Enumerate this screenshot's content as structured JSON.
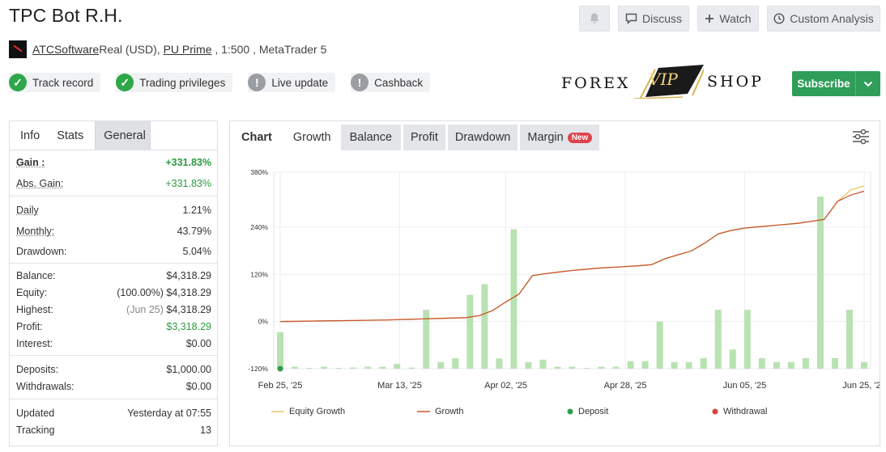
{
  "header": {
    "title": "TPC Bot R.H.",
    "author": "ATCSoftware",
    "account_type": "Real (USD), ",
    "broker": "PU Prime",
    "leverage_platform": " , 1:500 , MetaTrader 5"
  },
  "top_buttons": {
    "discuss": "Discuss",
    "watch": "Watch",
    "custom_analysis": "Custom Analysis"
  },
  "badges": [
    {
      "label": "Track record",
      "status": "ok"
    },
    {
      "label": "Trading privileges",
      "status": "ok"
    },
    {
      "label": "Live update",
      "status": "info"
    },
    {
      "label": "Cashback",
      "status": "info"
    }
  ],
  "ad": {
    "left": "FOREX",
    "mid": "VIP",
    "right": "SHOP"
  },
  "subscribe": {
    "label": "Subscribe"
  },
  "left_tabs": [
    "Info",
    "Stats",
    "General"
  ],
  "stats": {
    "gain_label": "Gain :",
    "gain": "+331.83%",
    "abs_gain_label": "Abs. Gain:",
    "abs_gain": "+331.83%",
    "daily_label": "Daily",
    "daily": "1.21%",
    "monthly_label": "Monthly:",
    "monthly": "43.79%",
    "drawdown_label": "Drawdown:",
    "drawdown": "5.04%",
    "balance_label": "Balance:",
    "balance": "$4,318.29",
    "equity_label": "Equity:",
    "equity_pct": "(100.00%)",
    "equity": "$4,318.29",
    "highest_label": "Highest:",
    "highest_date": "(Jun 25)",
    "highest": "$4,318.29",
    "profit_label": "Profit:",
    "profit": "$3,318.29",
    "interest_label": "Interest:",
    "interest": "$0.00",
    "deposits_label": "Deposits:",
    "deposits": "$1,000.00",
    "withdrawals_label": "Withdrawals:",
    "withdrawals": "$0.00",
    "updated_label": "Updated",
    "updated": "Yesterday at 07:55",
    "tracking_label": "Tracking",
    "tracking": "13"
  },
  "chart_tabs": {
    "chart": "Chart",
    "growth": "Growth",
    "balance": "Balance",
    "profit": "Profit",
    "drawdown": "Drawdown",
    "margin": "Margin",
    "new_badge": "New"
  },
  "chart_data": {
    "type": "line",
    "title": "",
    "ylim": [
      -120,
      380
    ],
    "y_ticks": [
      "380%",
      "240%",
      "120%",
      "0%",
      "-120%"
    ],
    "y_tick_values": [
      380,
      240,
      120,
      0,
      -120
    ],
    "x_ticks": [
      "Feb 25, '25",
      "Mar 13, '25",
      "Apr 02, '25",
      "Apr 28, '25",
      "Jun 05, '25",
      "Jun 25, '25"
    ],
    "x_tick_index": [
      0,
      9,
      17,
      26,
      35,
      44
    ],
    "grid": true,
    "legend_position": "bottom",
    "series": [
      {
        "name": "Equity Growth",
        "color": "#e8c96a",
        "values": [
          0,
          0.5,
          1,
          1.5,
          2,
          2.5,
          3,
          3.5,
          4,
          5,
          6,
          7,
          8,
          9,
          10,
          15,
          28,
          50,
          70,
          117,
          122,
          126,
          130,
          133,
          136,
          138,
          140,
          142,
          145,
          160,
          170,
          180,
          200,
          223,
          232,
          238,
          241,
          244,
          247,
          250,
          255,
          260,
          306,
          335,
          345
        ]
      },
      {
        "name": "Growth",
        "color": "#c8552e",
        "values": [
          0,
          0.5,
          1,
          1.5,
          2,
          2.5,
          3,
          3.5,
          4,
          5,
          6,
          7,
          8,
          9,
          10,
          15,
          28,
          50,
          70,
          117,
          122,
          126,
          130,
          133,
          136,
          138,
          140,
          142,
          145,
          160,
          170,
          180,
          200,
          223,
          232,
          238,
          241,
          244,
          247,
          250,
          255,
          260,
          306,
          322,
          332
        ]
      }
    ],
    "bars": [
      -27,
      -115,
      -118,
      -115,
      -118,
      -117,
      -115,
      -115,
      -108,
      -117,
      30,
      -103,
      -93,
      68,
      95,
      -94,
      235,
      -103,
      -97,
      -115,
      -115,
      -118,
      -115,
      -115,
      -101,
      -101,
      0,
      -103,
      -103,
      -93,
      30,
      -71,
      30,
      -93,
      -103,
      -103,
      -93,
      318,
      -93,
      30,
      -103
    ],
    "deposit_marker": {
      "label": "Deposit",
      "index": 0,
      "value": -120,
      "color": "#2e9e4a"
    },
    "withdrawal_marker": {
      "label": "Withdrawal",
      "color": "#d9423c"
    },
    "bar_color": "#b9e2b2"
  },
  "legend": {
    "equity_growth": "Equity Growth",
    "growth": "Growth",
    "deposit": "Deposit",
    "withdrawal": "Withdrawal"
  }
}
